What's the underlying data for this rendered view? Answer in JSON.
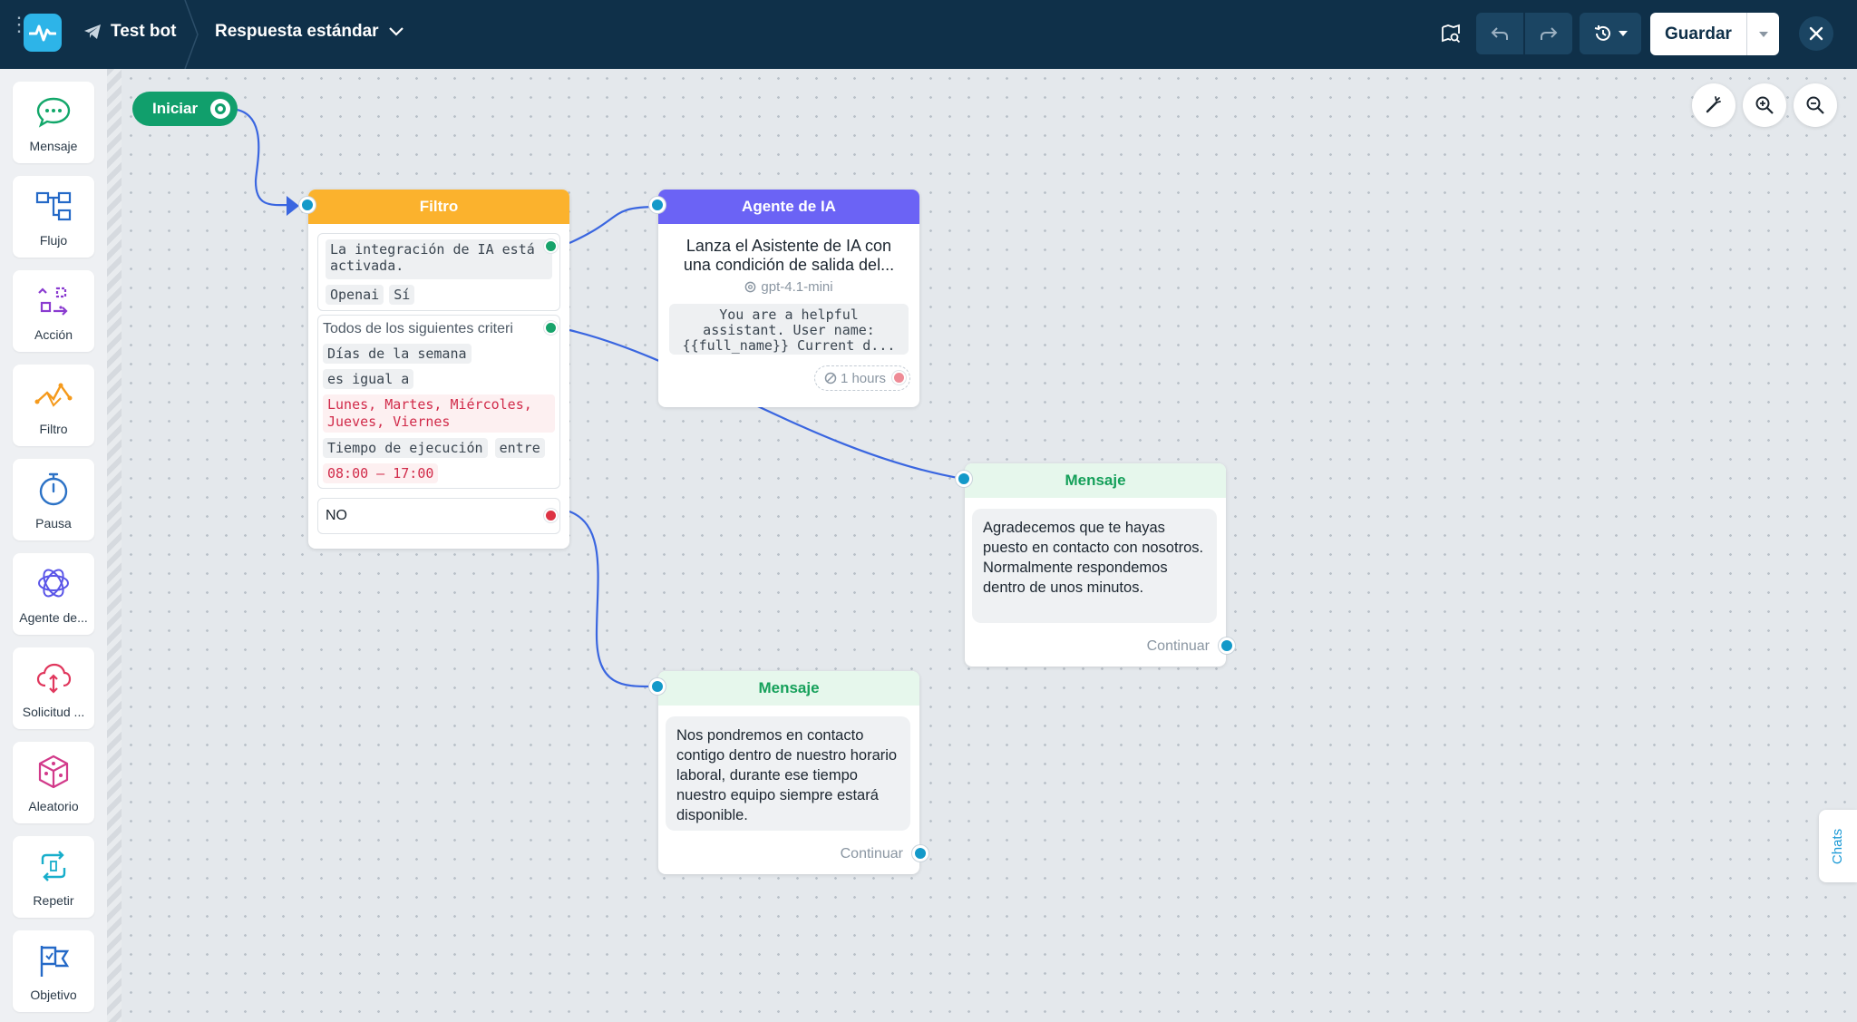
{
  "colors": {
    "topbar": "#0f3049",
    "filter_header": "#fbb22d",
    "ai_header": "#6b63f5",
    "message_header": "#e6f7ec",
    "message_title": "#15a05a",
    "start": "#119f6c",
    "edge": "#3a66e0",
    "port": "#1399c9"
  },
  "header": {
    "bot_name": "Test bot",
    "flow_name": "Respuesta estándar",
    "save_label": "Guardar"
  },
  "sidebar": {
    "items": [
      {
        "label": "Mensaje",
        "icon": "chat-bubble-icon"
      },
      {
        "label": "Flujo",
        "icon": "flow-icon"
      },
      {
        "label": "Acción",
        "icon": "action-icon"
      },
      {
        "label": "Filtro",
        "icon": "filter-icon"
      },
      {
        "label": "Pausa",
        "icon": "stopwatch-icon"
      },
      {
        "label": "Agente de...",
        "icon": "ai-agent-icon"
      },
      {
        "label": "Solicitud ...",
        "icon": "cloud-request-icon"
      },
      {
        "label": "Aleatorio",
        "icon": "dice-icon"
      },
      {
        "label": "Repetir",
        "icon": "repeat-icon"
      },
      {
        "label": "Objetivo",
        "icon": "goal-flag-icon"
      }
    ]
  },
  "canvas": {
    "start_label": "Iniciar",
    "filter_node": {
      "title": "Filtro",
      "cond1_text": "La integración de IA está activada.",
      "cond1_chip_a": "Openai",
      "cond1_chip_b": "Sí",
      "cond2_title": "Todos de los siguientes criteri",
      "cond2_field": "Días de la semana",
      "cond2_op": "es igual a",
      "cond2_value": "Lunes, Martes, Miércoles, Jueves, Viernes",
      "cond2_field2": "Tiempo de ejecución",
      "cond2_op2": "entre",
      "cond2_value2": "08:00 — 17:00",
      "no_label": "NO"
    },
    "ai_node": {
      "title": "Agente de IA",
      "description": "Lanza el Asistente de IA con una condición de salida del...",
      "model": "gpt-4.1-mini",
      "prompt": "You are a helpful assistant. User name: {{full_name}} Current d...",
      "timeout": "1 hours"
    },
    "message_node_1": {
      "title": "Mensaje",
      "text": "Agradecemos que te hayas puesto en contacto con nosotros. Normalmente respondemos dentro de unos minutos.",
      "continue_label": "Continuar"
    },
    "message_node_2": {
      "title": "Mensaje",
      "text": "Nos pondremos en contacto contigo dentro de nuestro horario laboral, durante ese tiempo nuestro equipo siempre estará disponible.",
      "continue_label": "Continuar"
    }
  },
  "chats_tab_label": "Chats"
}
